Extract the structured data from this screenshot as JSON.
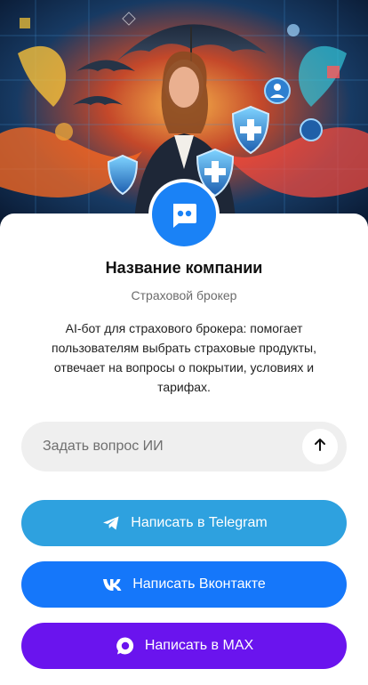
{
  "hero": {
    "image": "insurance-agent-illustration"
  },
  "profile": {
    "avatar_icon": "chat-bot-icon",
    "company_name": "Название компании",
    "company_type": "Страховой брокер",
    "description": "AI-бот для страхового брокера: помогает пользователям выбрать страховые продукты, отвечает на вопросы о покрытии, условиях и тарифах."
  },
  "ask": {
    "placeholder": "Задать вопрос ИИ",
    "value": "",
    "send_icon": "arrow-up-icon"
  },
  "buttons": {
    "telegram": {
      "label": "Написать в Telegram",
      "icon": "telegram-icon",
      "color": "#2ea1df"
    },
    "vk": {
      "label": "Написать Вконтакте",
      "icon": "vk-icon",
      "color": "#1577fa"
    },
    "max": {
      "label": "Написать в MAX",
      "icon": "max-icon",
      "color": "#6a14ee"
    }
  },
  "colors": {
    "accent": "#1a82f6",
    "input_bg": "#efefef"
  }
}
